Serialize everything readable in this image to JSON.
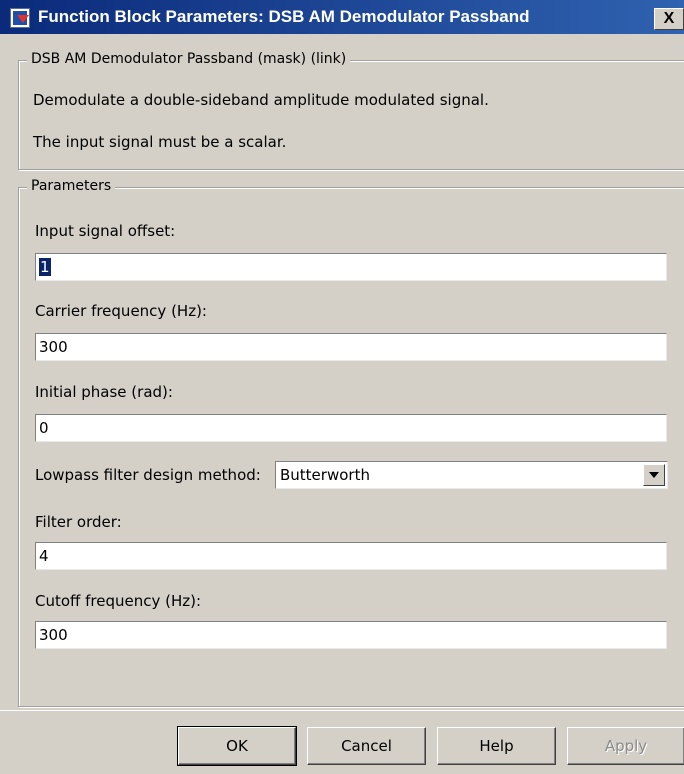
{
  "window": {
    "title": "Function Block Parameters: DSB AM Demodulator Passband",
    "close_label": "X"
  },
  "mask": {
    "legend": "DSB AM Demodulator Passband (mask) (link)",
    "description": "Demodulate a double-sideband amplitude modulated signal.",
    "note": "The input signal must be a scalar."
  },
  "parameters": {
    "legend": "Parameters",
    "input_offset": {
      "label": "Input signal offset:",
      "value": "1"
    },
    "carrier_frequency": {
      "label": "Carrier frequency (Hz):",
      "value": "300"
    },
    "initial_phase": {
      "label": "Initial phase (rad):",
      "value": "0"
    },
    "filter_method": {
      "label": "Lowpass filter design method:",
      "value": "Butterworth"
    },
    "filter_order": {
      "label": "Filter order:",
      "value": "4"
    },
    "cutoff_frequency": {
      "label": "Cutoff frequency (Hz):",
      "value": "300"
    }
  },
  "buttons": {
    "ok": "OK",
    "cancel": "Cancel",
    "help": "Help",
    "apply": "Apply"
  },
  "colors": {
    "title_bar": "#0b2a7a",
    "dialog_bg": "#d4d0c8",
    "selection": "#0a246a"
  },
  "icons": {
    "title": "simulink-block-icon",
    "dropdown": "chevron-down-icon"
  }
}
